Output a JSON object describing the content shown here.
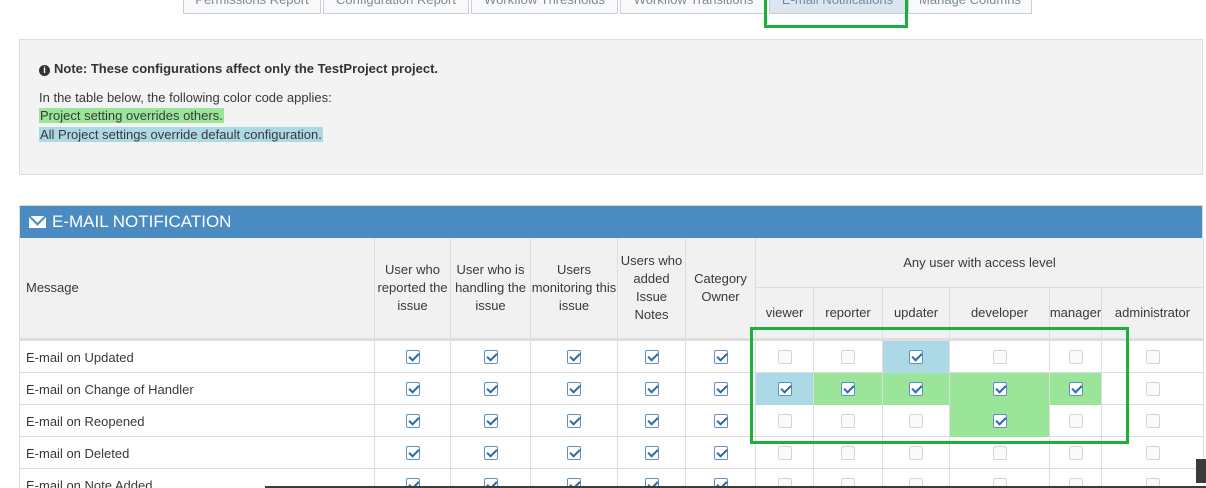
{
  "tabs": [
    {
      "label": "Permissions Report",
      "active": false
    },
    {
      "label": "Configuration Report",
      "active": false
    },
    {
      "label": "Workflow Thresholds",
      "active": false
    },
    {
      "label": "Workflow Transitions",
      "active": false
    },
    {
      "label": "E-mail Notifications",
      "active": true
    },
    {
      "label": "Manage Columns",
      "active": false
    }
  ],
  "note": {
    "title": "Note: These configurations affect only the TestProject project.",
    "intro": "In the table below, the following color code applies:",
    "green_legend": "Project setting overrides others.",
    "blue_legend": "All Project settings override default configuration."
  },
  "widget": {
    "title": "E-MAIL NOTIFICATION",
    "icon": "envelope-icon"
  },
  "table": {
    "headers": {
      "message": "Message",
      "reporter": "User who reported the issue",
      "handler": "User who is handling the issue",
      "monitoring": "Users monitoring this issue",
      "notes": "Users who added Issue Notes",
      "category_owner": "Category Owner",
      "access_level_group": "Any user with access level",
      "levels": [
        "viewer",
        "reporter",
        "updater",
        "developer",
        "manager",
        "administrator"
      ]
    },
    "rows": [
      {
        "message": "E-mail on Updated",
        "fixed": [
          true,
          true,
          true,
          true,
          true
        ],
        "levels": [
          false,
          false,
          true,
          false,
          false,
          false
        ],
        "level_colors": [
          "",
          "",
          "blue",
          "",
          "",
          ""
        ]
      },
      {
        "message": "E-mail on Change of Handler",
        "fixed": [
          true,
          true,
          true,
          true,
          true
        ],
        "levels": [
          true,
          true,
          true,
          true,
          true,
          false
        ],
        "level_colors": [
          "blue",
          "green",
          "green",
          "green",
          "green",
          ""
        ]
      },
      {
        "message": "E-mail on Reopened",
        "fixed": [
          true,
          true,
          true,
          true,
          true
        ],
        "levels": [
          false,
          false,
          false,
          true,
          false,
          false
        ],
        "level_colors": [
          "",
          "",
          "",
          "green",
          "",
          ""
        ]
      },
      {
        "message": "E-mail on Deleted",
        "fixed": [
          true,
          true,
          true,
          true,
          true
        ],
        "levels": [
          false,
          false,
          false,
          false,
          false,
          false
        ],
        "level_colors": [
          "",
          "",
          "",
          "",
          "",
          ""
        ]
      },
      {
        "message": "E-mail on Note Added",
        "fixed": [
          true,
          true,
          true,
          true,
          true
        ],
        "levels": [
          false,
          false,
          false,
          false,
          false,
          false
        ],
        "level_colors": [
          "",
          "",
          "",
          "",
          "",
          ""
        ]
      }
    ]
  },
  "colors": {
    "green": "#9ae59a",
    "blue": "#add8e6",
    "header": "#4a8bc2",
    "highlight": "#1eae3c"
  }
}
